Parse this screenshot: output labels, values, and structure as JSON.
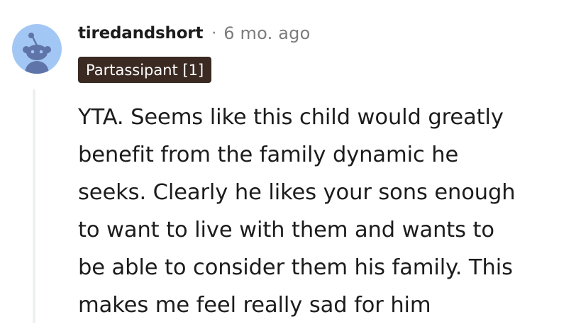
{
  "comment": {
    "author": "tiredandshort",
    "separator": "·",
    "timestamp": "6 mo. ago",
    "flair": "Partassipant [1]",
    "avatar_icon": "reddit-snoo-avatar-icon",
    "body_lines": [
      "YTA. Seems like this child would greatly",
      "benefit from the family dynamic he",
      "seeks. Clearly he likes your sons enough",
      "to want to live with them and wants to",
      "be able to consider them his family. This",
      "makes me feel really sad for him"
    ]
  },
  "colors": {
    "avatar_bg": "#a3c7f5",
    "avatar_figure": "#5f74a8",
    "flair_bg": "#3a2a22",
    "meta_gray": "#7c7c7c",
    "text": "#1c1c1c",
    "thread_line": "#edeff1"
  }
}
